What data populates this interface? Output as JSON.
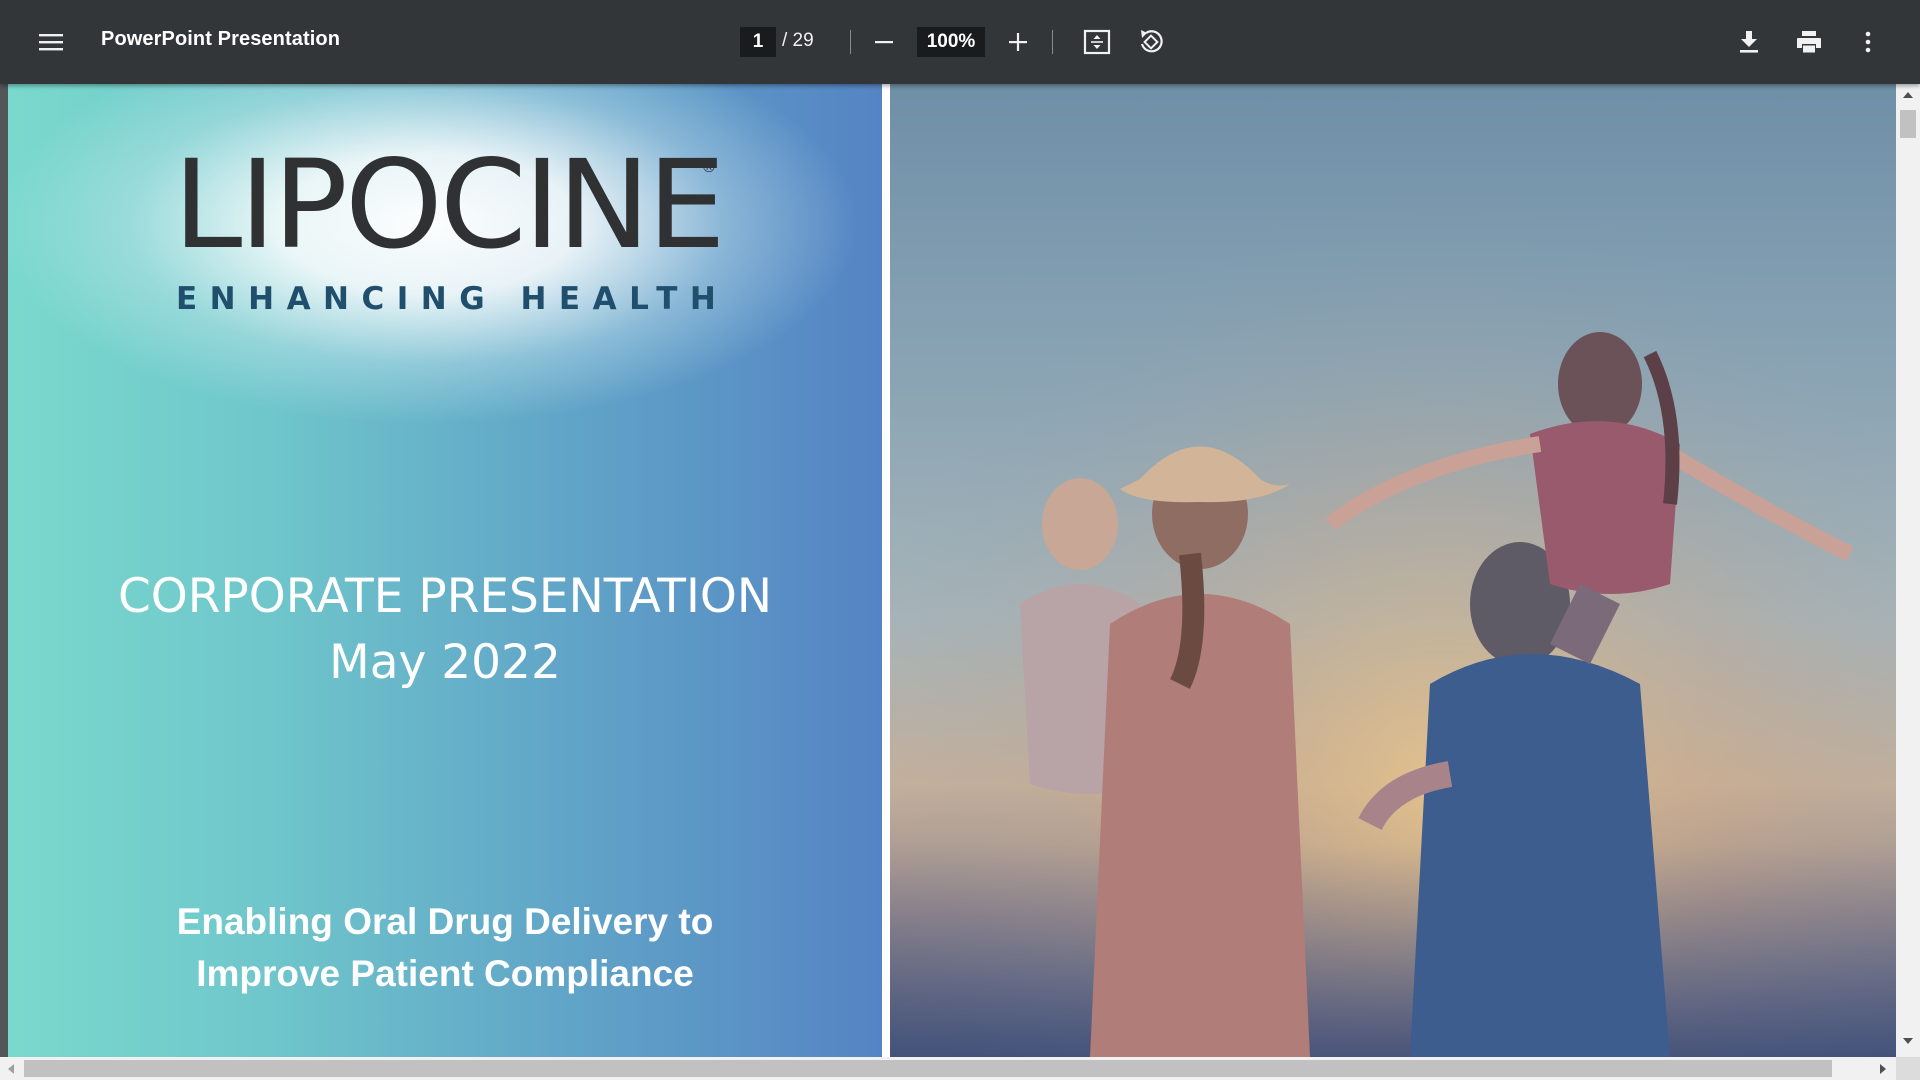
{
  "toolbar": {
    "menu_icon": "hamburger-menu-icon",
    "title": "PowerPoint Presentation",
    "current_page": "1",
    "total_pages": "/ 29",
    "zoom_out_icon": "minus-icon",
    "zoom_level": "100%",
    "zoom_in_icon": "plus-icon",
    "fit_icon": "fit-to-page-icon",
    "rotate_icon": "rotate-counterclockwise-icon",
    "download_icon": "download-icon",
    "print_icon": "print-icon",
    "more_icon": "more-vertical-icon"
  },
  "slide": {
    "logo_word": "LIPOCINE",
    "logo_registered": "®",
    "logo_tagline": "ENHANCING HEALTH",
    "title_line1": "CORPORATE PRESENTATION",
    "title_line2": "May 2022",
    "tagline_line1": "Enabling Oral Drug Delivery to",
    "tagline_line2": "Improve Patient Compliance"
  },
  "colors": {
    "toolbar_bg": "#323639",
    "viewer_bg": "#525659",
    "slide_gradient_left": "#7ad9cd",
    "slide_gradient_right": "#5584c4",
    "logo_text": "#2f3133",
    "logo_tagline": "#1f4f6d"
  }
}
